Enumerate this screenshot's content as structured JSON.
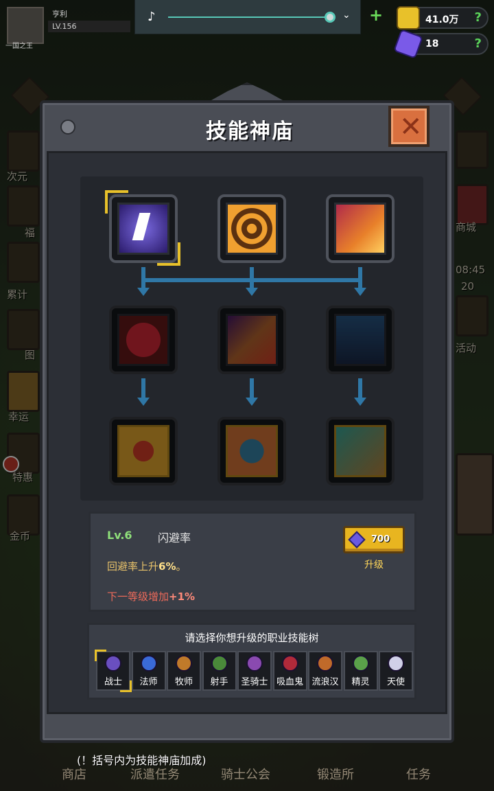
{
  "player": {
    "name": "亨利",
    "level": "LV.156",
    "title": "一国之王"
  },
  "music": {
    "note_icon": "music-note-icon",
    "dropdown_icon": "chevron-down-icon"
  },
  "currency": {
    "gold": {
      "value": "41.0万",
      "help": "?"
    },
    "gem": {
      "value": "18",
      "help": "?"
    },
    "add": "+"
  },
  "side_labels": [
    "次元",
    "福",
    "累计",
    "图",
    "幸运",
    "特惠",
    "金币"
  ],
  "right_labels": [
    "商城",
    "08:45",
    "20",
    "活动"
  ],
  "modal": {
    "title": "技能神庙",
    "close": "✕"
  },
  "skill_tree": {
    "rows": [
      [
        "dodge-skill",
        "target-skill",
        "burst-skill"
      ],
      [
        "heal-skill",
        "club-skill",
        "cloak-skill"
      ],
      [
        "armor-skill",
        "shield-skill",
        "sword-skill"
      ]
    ],
    "selected": "dodge-skill"
  },
  "skill_info": {
    "level": "Lv.6",
    "name": "闪避率",
    "desc_prefix": "回避率上升",
    "desc_value": "6%",
    "desc_suffix": "。",
    "next_prefix": "下一等级增加",
    "next_value": "+1%",
    "upgrade_cost": "700",
    "upgrade_label": "升级"
  },
  "class_select": {
    "title": "请选择你想升级的职业技能树",
    "classes": [
      "战士",
      "法师",
      "牧师",
      "射手",
      "圣骑士",
      "吸血鬼",
      "流浪汉",
      "精灵",
      "天使"
    ],
    "colors": [
      "#6a4fc0",
      "#3a6ad8",
      "#c07a2a",
      "#4a8a3a",
      "#8a4ab0",
      "#b02a3a",
      "#c06a2a",
      "#5aa04a",
      "#d0d0e8"
    ],
    "selected": 0
  },
  "footer_note": "(！括号内为技能神庙加成)",
  "bottom_nav": [
    "商店",
    "派遣任务",
    "骑士公会",
    "锻造所",
    "任务"
  ]
}
